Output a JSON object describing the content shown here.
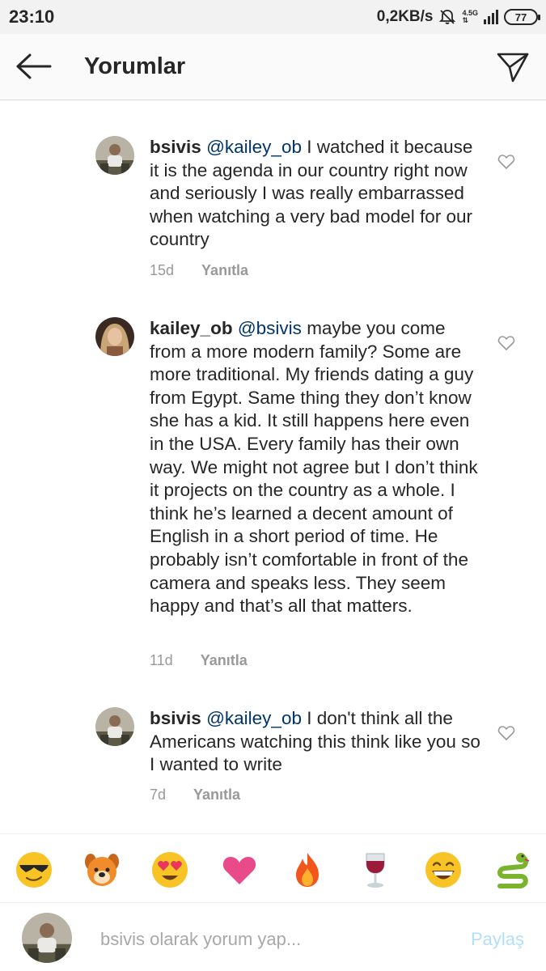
{
  "status_bar": {
    "time": "23:10",
    "net_speed": "0,2KB/s",
    "net_type_top": "4.5G",
    "net_type_bottom": "⇅",
    "battery": "77",
    "icons": [
      "mute-icon",
      "signal-icon",
      "battery-icon"
    ]
  },
  "header": {
    "title": "Yorumlar",
    "back_icon": "arrow-left-icon",
    "send_icon": "paper-plane-icon"
  },
  "comments": [
    {
      "username": "bsivis",
      "mention": "@kailey_ob",
      "text": " I watched it because it is the agenda in our country right now and seriously I was really embarrassed when watching a very bad model for our country",
      "time": "15d",
      "reply": "Yanıtla"
    },
    {
      "username": "kailey_ob",
      "mention": "@bsivis",
      "text": " maybe you come from a more modern family? Some are more traditional. My friends dating a guy from Egypt. Same thing they don’t know she has a kid. It still happens here even in the USA. Every family has their own way. We might not agree but I don’t think it projects on the country as a whole. I think he’s learned a decent amount of English in a short period of time. He probably isn’t comfortable in front of the camera and speaks less. They seem happy and that’s all that matters.",
      "time": "11d",
      "reply": "Yanıtla"
    },
    {
      "username": "bsivis",
      "mention": "@kailey_ob",
      "text": " I don't think all the Americans watching this think like you so I wanted to write",
      "time": "7d",
      "reply": "Yanıtla"
    }
  ],
  "emoji_bar": [
    "sunglasses-emoji",
    "dog-emoji",
    "heart-eyes-emoji",
    "heart-emoji",
    "fire-emoji",
    "wine-emoji",
    "grinning-emoji",
    "snake-emoji"
  ],
  "composer": {
    "placeholder": "bsivis olarak yorum yap...",
    "post_label": "Paylaş"
  },
  "colors": {
    "mention": "#003569",
    "meta": "#999999",
    "post_disabled": "#b2dffc"
  }
}
